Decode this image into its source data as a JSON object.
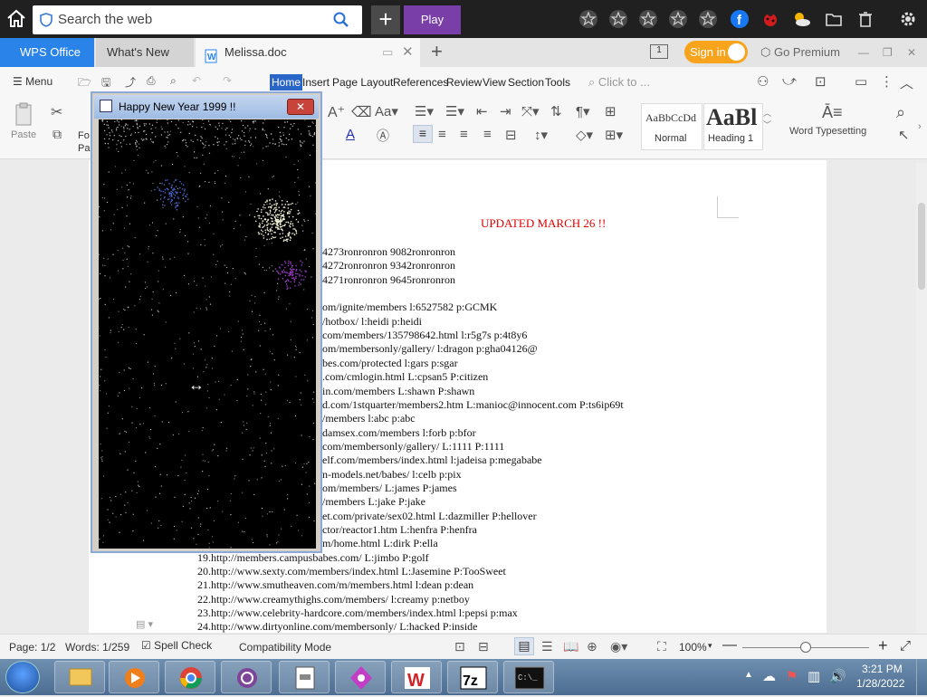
{
  "browser": {
    "search_placeholder": "Search the web",
    "play_label": "Play"
  },
  "tabs": {
    "wps": "WPS Office",
    "whats_new": "What's New",
    "doc": "Melissa.doc",
    "signin": "Sign in",
    "premium": "Go Premium"
  },
  "menu": {
    "menu_label": "Menu",
    "tabs": [
      "Home",
      "Insert",
      "Page Layout",
      "References",
      "Review",
      "View",
      "Section",
      "Tools"
    ],
    "click_to": "Click to ..."
  },
  "ribbon": {
    "paste": "Paste",
    "format": "Fo",
    "format2": "Pa",
    "style_normal_sample": "AaBbCcDd",
    "style_normal": "Normal",
    "style_heading_sample": "AaBl",
    "style_heading": "Heading 1",
    "word_typesetting": "Word Typesetting"
  },
  "popup": {
    "title": "Happy New Year 1999 !!"
  },
  "document": {
    "heading": "UPDATED MARCH 26 !!",
    "lines": [
      "4273ronronron 9082ronronron",
      "4272ronronron 9342ronronron",
      "4271ronronron 9645ronronron",
      "",
      "om/ignite/members l:6527582 p:GCMK",
      "/hotbox/ l:heidi p:heidi",
      "com/members/135798642.html l:r5g7s p:4t8y6",
      "om/membersonly/gallery/ l:dragon p:gha04126@",
      "bes.com/protected l:gars p:sgar",
      ".com/cmlogin.html L:cpsan5 P:citizen",
      "in.com/members L:shawn P:shawn",
      "d.com/1stquarter/members2.htm L:manioc@innocent.com P:ts6ip69t",
      "/members l:abc p:abc",
      "damsex.com/members l:forb p:bfor",
      "com/membersonly/gallery/  L:1111 P:1111",
      "elf.com/members/index.html l:jadeisa p:megababe",
      "n-models.net/babes/ l:celb p:pix",
      "om/members/  L:james P:james",
      "/members L:jake P:jake",
      "et.com/private/sex02.html L:dazmiller  P:hellover",
      "ctor/reactor1.htm L:henfra P:henfra",
      "m/home.html L:dirk P:ella",
      "19.http://members.campusbabes.com/ L:jimbo P:golf",
      "20.http://www.sexty.com/members/index.html L:Jasemine P:TooSweet",
      "21.http://www.smutheaven.com/m/members.html l:dean p:dean",
      "22.http://www.creamythighs.com/members/ l:creamy p:netboy",
      "23.http://www.celebrity-hardcore.com/members/index.html l:pepsi p:max",
      "24.http://www.dirtyonline.com/membersonly/  L:hacked P:inside"
    ]
  },
  "status": {
    "page": "Page: 1/2",
    "words": "Words: 1/259",
    "spell": "Spell Check",
    "compat": "Compatibility Mode",
    "zoom": "100%"
  },
  "taskbar": {
    "time": "3:21 PM",
    "date": "1/28/2022"
  }
}
